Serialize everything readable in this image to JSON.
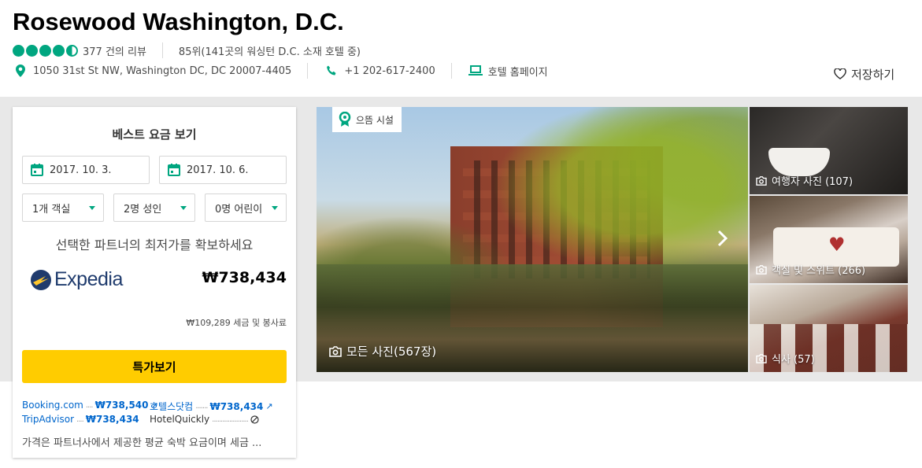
{
  "hotel": {
    "name": "Rosewood Washington, D.C.",
    "rating_bubbles": 4.5,
    "review_count": "377 건의 리뷰",
    "ranking": "85위(141곳의 워싱턴 D.C. 소재 호텔 중)",
    "address": "1050 31st St NW, Washington DC, DC 20007-4405",
    "phone": "+1 202-617-2400",
    "website_label": "호텔 홈페이지",
    "save_label": "저장하기"
  },
  "booking": {
    "title": "베스트 요금 보기",
    "checkin": "2017. 10. 3.",
    "checkout": "2017. 10. 6.",
    "rooms": "1개 객실",
    "adults": "2명 성인",
    "children": "0명 어린이",
    "promo_text": "선택한 파트너의 최저가를 확보하세요",
    "partner_logo": "Expedia",
    "price": "₩738,434",
    "tax_note": "₩109,289 세금 및 봉사료",
    "deal_button": "특가보기",
    "partners": [
      {
        "name": "Booking.com",
        "price": "₩738,540",
        "icon": "external-arrow-icon"
      },
      {
        "name": "호텔스닷컴",
        "price": "₩738,434",
        "icon": "external-arrow-icon"
      },
      {
        "name": "TripAdvisor",
        "price": "₩738,434",
        "icon": ""
      },
      {
        "name": "HotelQuickly",
        "price": "",
        "icon": "unavailable-icon"
      }
    ],
    "disclaimer": "가격은 파트너사에서 제공한 평균 숙박 요금이며 세금 ..."
  },
  "gallery": {
    "badge": "으뜸 시설",
    "main_label": "모든 사진(567장)",
    "thumbs": [
      {
        "label": "여행자 사진 (107)"
      },
      {
        "label": "객실 및 스위트 (266)"
      },
      {
        "label": "식사 (57)"
      }
    ]
  },
  "colors": {
    "brand_green": "#00a680",
    "button_yellow": "#ffcc00",
    "link_blue": "#0066cc",
    "band_gray": "#e8e8e8"
  }
}
